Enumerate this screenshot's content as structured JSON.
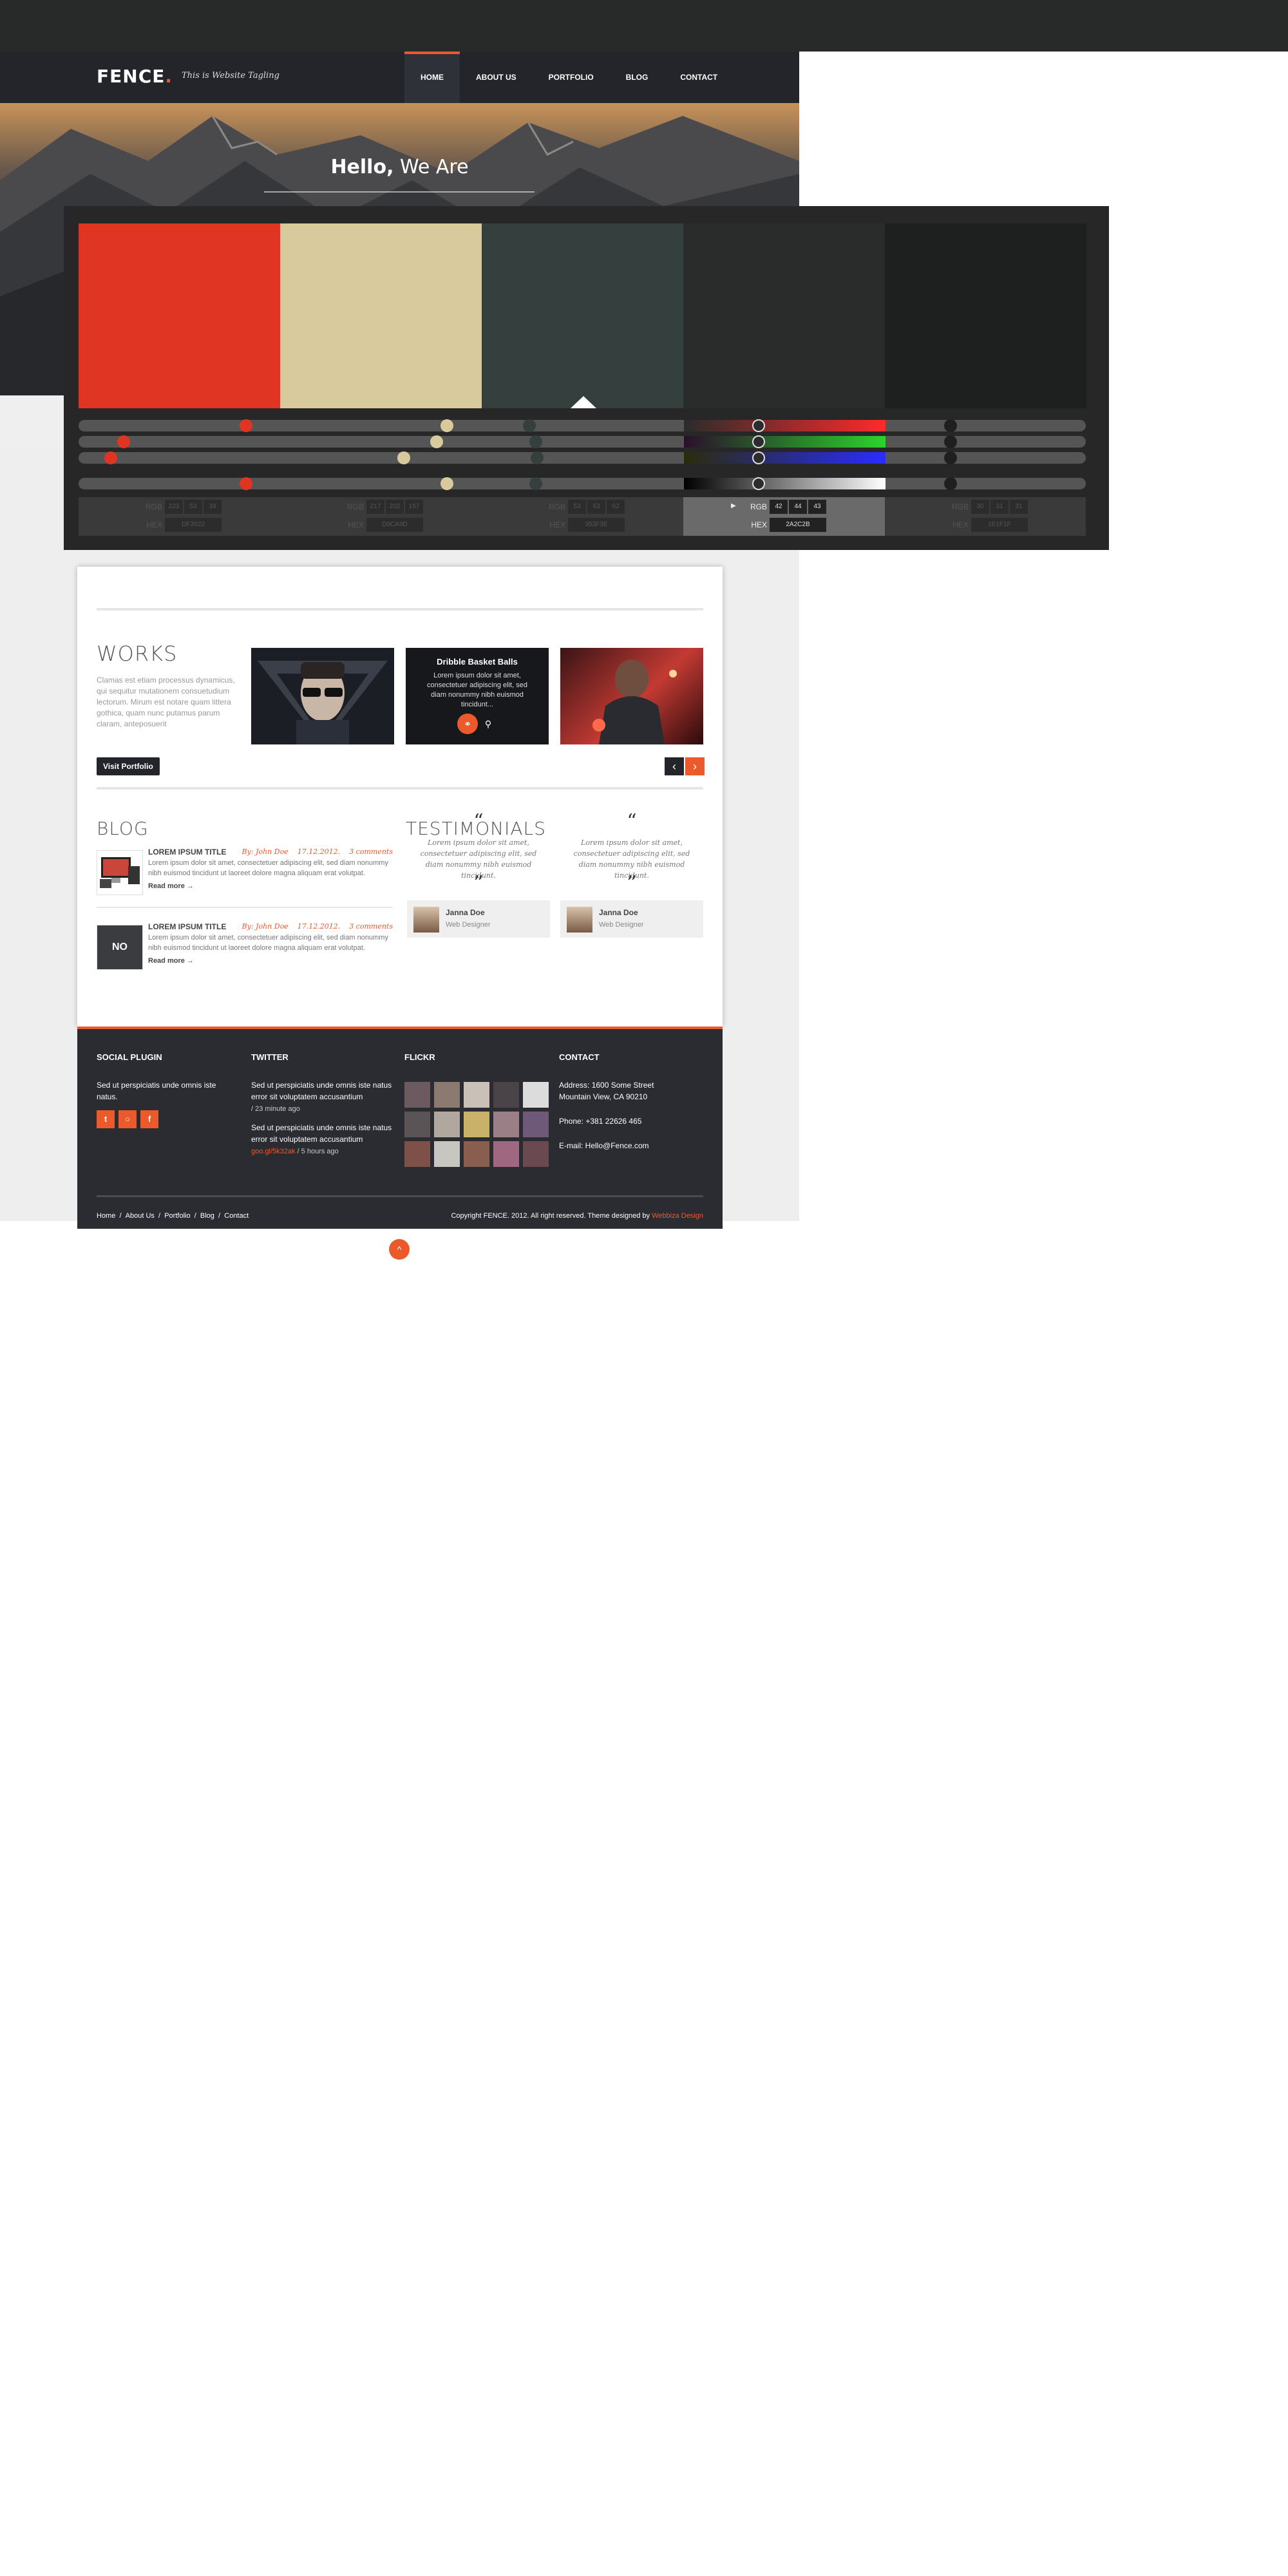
{
  "site": {
    "logo": "FENCE",
    "logo_dot": ".",
    "tagline": "This is Website Tagling",
    "nav": [
      "HOME",
      "ABOUT US",
      "PORTFOLIO",
      "BLOG",
      "CONTACT"
    ],
    "hero_title_bold": "Hello,",
    "hero_title_rest": " We Are"
  },
  "works": {
    "title": "WORKS",
    "text": "Clamas est etiam processus dynamicus, qui sequitur mutationem consuetudium lectorum. Mirum est notare quam littera gothica, quam nunc putamus parum claram, anteposuerit",
    "button": "Visit Portfolio",
    "hover_title": "Dribble Basket Balls",
    "hover_text": "Lorem ipsum dolor sit amet, consectetuer adipiscing elit, sed diam nonummy nibh euismod tincidunt..."
  },
  "blog": {
    "title": "BLOG",
    "posts": [
      {
        "title": "LOREM IPSUM TITLE",
        "author": "By: John Doe",
        "date": "17.12.2012.",
        "comments": "3 comments",
        "text": "Lorem ipsum dolor sit amet, consectetuer adipiscing elit, sed diam nonummy nibh euismod tincidunt ut laoreet dolore magna aliquam erat volutpat.",
        "more": "Read more →",
        "thumb_label": ""
      },
      {
        "title": "LOREM IPSUM TITLE",
        "author": "By: John Doe",
        "date": "17.12.2012.",
        "comments": "3 comments",
        "text": "Lorem ipsum dolor sit amet, consectetuer adipiscing elit, sed diam nonummy nibh euismod tincidunt ut laoreet dolore magna aliquam erat volutpat.",
        "more": "Read more →",
        "thumb_label": "NO"
      }
    ]
  },
  "testimonials": {
    "title": "TESTIMONIALS",
    "open_quote": "“",
    "close_quote": "”",
    "items": [
      {
        "text": "Lorem ipsum dolor sit amet, consectetuer adipiscing elit, sed diam nonummy nibh euismod tincidunt.",
        "name": "Janna Doe",
        "role": "Web Designer"
      },
      {
        "text": "Lorem ipsum dolor sit amet, consectetuer adipiscing elit, sed diam nonummy nibh euismod tincidunt.",
        "name": "Janna Doe",
        "role": "Web Designer"
      }
    ]
  },
  "footer": {
    "social_title": "SOCIAL PLUGIN",
    "social_text": "Sed ut perspiciatis unde omnis iste natus.",
    "twitter_title": "TWITTER",
    "tweets": [
      {
        "text": "Sed ut perspiciatis unde omnis iste natus error sit voluptatem accusantium",
        "link": "",
        "time": "/ 23 minute ago"
      },
      {
        "text": "Sed ut perspiciatis unde omnis iste natus error sit voluptatem accusantium",
        "link": "goo.gl/5k32ak",
        "time": " / 5 hours ago"
      }
    ],
    "flickr_title": "FLICKR",
    "contact_title": "CONTACT",
    "address_1": "Address: 1600 Some Street",
    "address_2": "Mountain View, CA 90210",
    "phone": "Phone: +381 22626 465",
    "email": "E-mail:  Hello@Fence.com",
    "links": [
      "Home",
      "About Us",
      "Portfolio",
      "Blog",
      "Contact"
    ],
    "link_separator": "/",
    "copyright": "Copyright  FENCE. 2012. All right reserved. Theme designed by ",
    "designer": "Webbiza Design"
  },
  "palette": {
    "swatches": [
      "#DF3522",
      "#D9CA9D",
      "#353F3E",
      "#2A2C2B",
      "#1E1F1F"
    ],
    "rgb_label": "RGB",
    "hex_label": "HEX",
    "selected_index": 3,
    "values": [
      {
        "rgb": [
          "223",
          "53",
          "34"
        ],
        "hex": "DF3522"
      },
      {
        "rgb": [
          "217",
          "202",
          "157"
        ],
        "hex": "D9CA9D"
      },
      {
        "rgb": [
          "53",
          "63",
          "62"
        ],
        "hex": "353F3E"
      },
      {
        "rgb": [
          "42",
          "44",
          "43"
        ],
        "hex": "2A2C2B"
      },
      {
        "rgb": [
          "30",
          "31",
          "31"
        ],
        "hex": "1E1F1F"
      }
    ]
  },
  "icons": {
    "twitter": "twitter-icon",
    "dribbble": "dribbble-icon",
    "facebook": "facebook-icon",
    "arrow_left": "‹",
    "arrow_right": "›",
    "to_top": "^"
  },
  "colors": {
    "accent": "#EC5A2B",
    "dark": "#23252B"
  }
}
